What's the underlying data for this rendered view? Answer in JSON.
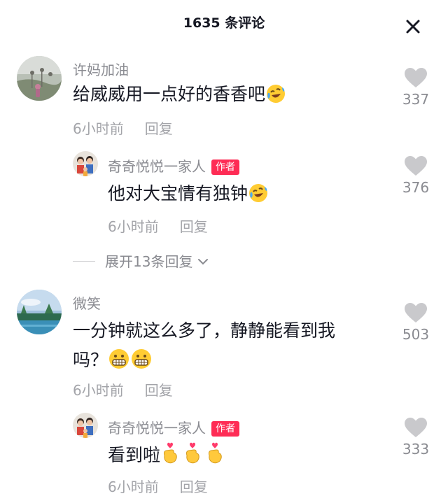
{
  "header": {
    "title": "1635 条评论"
  },
  "comments": [
    {
      "name": "许妈加油",
      "text": "给威威用一点好的香香吧",
      "emoji": "laughing-tears-emoji",
      "time": "6小时前",
      "reply_label": "回复",
      "likes": "337"
    },
    {
      "name": "奇奇悦悦一家人",
      "badge": "作者",
      "text": "他对大宝情有独钟",
      "emoji": "laughing-tears-emoji",
      "time": "6小时前",
      "reply_label": "回复",
      "likes": "376"
    },
    {
      "name": "微笑",
      "text_line1": "一分钟就这么多了，静静能看到我",
      "text_line2": "吗？",
      "emoji": "grinning-emoji",
      "time": "6小时前",
      "reply_label": "回复",
      "likes": "503"
    },
    {
      "name": "奇奇悦悦一家人",
      "badge": "作者",
      "text": "看到啦",
      "emoji": "finger-heart-emoji",
      "time": "6小时前",
      "reply_label": "回复",
      "likes": "333"
    }
  ],
  "expand": {
    "label": "展开13条回复"
  },
  "colors": {
    "badge": "#fe2c55",
    "heart": "#c9c9cc"
  }
}
